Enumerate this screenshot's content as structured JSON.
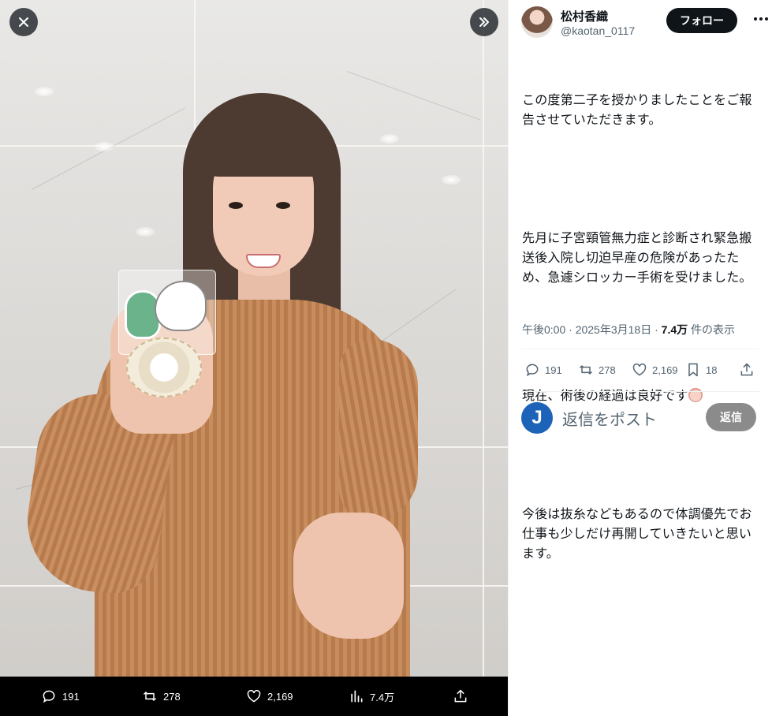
{
  "photo": {
    "stats": {
      "replies": "191",
      "reposts": "278",
      "likes": "2,169",
      "views": "7.4万"
    }
  },
  "tweet": {
    "author": {
      "display_name": "松村香織",
      "handle": "@kaotan_0117"
    },
    "follow_label": "フォロー",
    "paragraphs": [
      "この度第二子を授かりましたことをご報告させていただきます。",
      "先月に子宮頸管無力症と診断され緊急搬送後入院し切迫早産の危険があったため、急遽シロッカー手術を受けました。",
      "現在、術後の経過は良好です",
      "今後は抜糸などもあるので体調優先でお仕事も少しだけ再開していきたいと思います。"
    ],
    "meta": {
      "time": "午後0:00",
      "separator": "·",
      "date": "2025年3月18日",
      "separator2": "·",
      "views_count": "7.4万",
      "views_label": "件の表示"
    },
    "actions": {
      "replies": "191",
      "reposts": "278",
      "likes": "2,169",
      "bookmarks": "18"
    },
    "reply_box": {
      "avatar_letter": "J",
      "placeholder": "返信をポスト",
      "button_label": "返信"
    }
  },
  "colors": {
    "text_primary": "#0f1419",
    "text_secondary": "#536471",
    "follow_bg": "#0f1419",
    "reply_button_bg": "#8b8b8b",
    "reply_avatar_bg": "#1d63b7"
  },
  "icons": [
    "close-icon",
    "expand-icon",
    "reply-icon",
    "repost-icon",
    "like-icon",
    "views-icon",
    "share-icon",
    "bookmark-icon",
    "more-icon"
  ]
}
